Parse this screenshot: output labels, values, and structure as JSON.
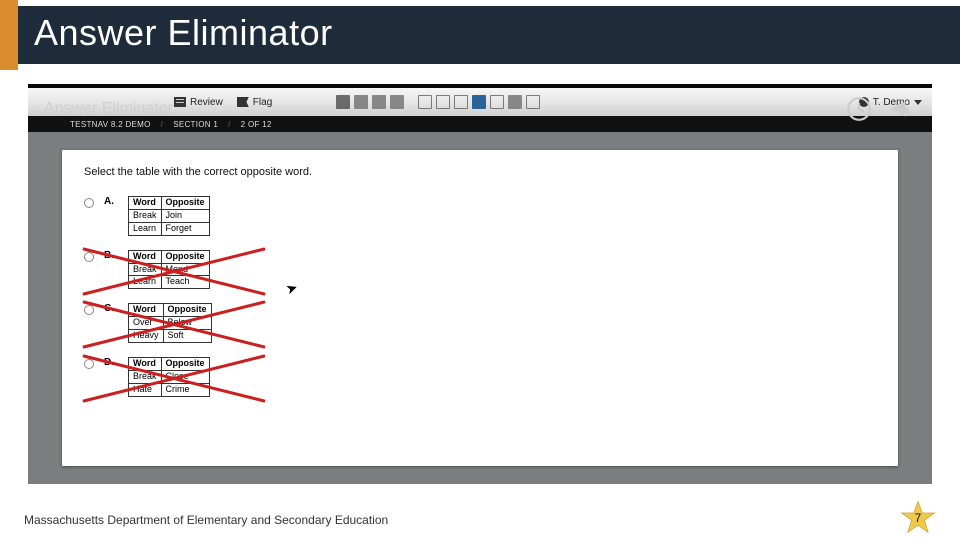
{
  "slide": {
    "title": "Answer Eliminator",
    "footer": "Massachusetts Department of Elementary and Secondary Education",
    "page_number": "7"
  },
  "video": {
    "overlay_title": "Answer Eliminator",
    "user_label": "T. Demo"
  },
  "toolbar": {
    "review_label": "Review",
    "flag_label": "Flag"
  },
  "crumb": {
    "product": "TESTNAV 8.2 DEMO",
    "section": "SECTION 1",
    "progress": "2 OF 12"
  },
  "question": {
    "prompt": "Select the table with the correct opposite word.",
    "header": [
      "Word",
      "Opposite"
    ],
    "choices": [
      {
        "label": "A.",
        "eliminated": false,
        "rows": [
          [
            "Break",
            "Join"
          ],
          [
            "Learn",
            "Forget"
          ]
        ]
      },
      {
        "label": "B.",
        "eliminated": true,
        "rows": [
          [
            "Break",
            "Mend"
          ],
          [
            "Learn",
            "Teach"
          ]
        ]
      },
      {
        "label": "C.",
        "eliminated": true,
        "rows": [
          [
            "Over",
            "Below"
          ],
          [
            "Heavy",
            "Soft"
          ]
        ]
      },
      {
        "label": "D.",
        "eliminated": true,
        "rows": [
          [
            "Break",
            "Close"
          ],
          [
            "Hate",
            "Crime"
          ]
        ]
      }
    ]
  }
}
